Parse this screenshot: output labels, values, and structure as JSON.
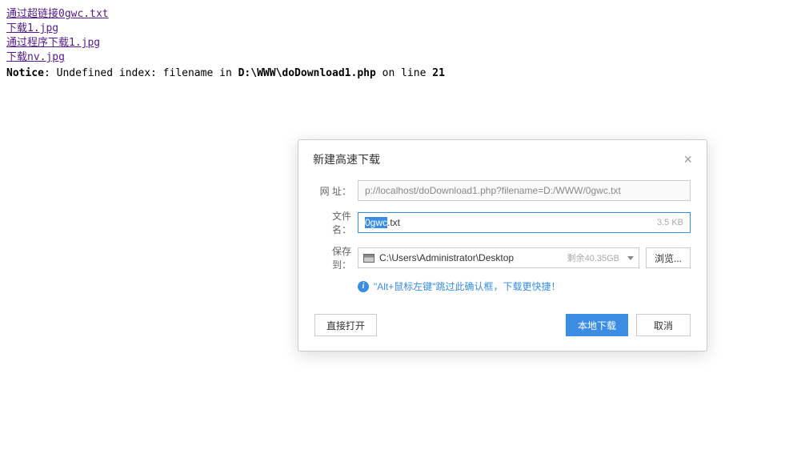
{
  "links": [
    "通过超链接0gwc.txt",
    "下载1.jpg",
    "通过程序下载1.jpg",
    "下载nv.jpg"
  ],
  "notice": {
    "prefix": "Notice",
    "message": ": Undefined index: filename in ",
    "path": "D:\\WWW\\doDownload1.php",
    "tail": " on line ",
    "line": "21"
  },
  "dialog": {
    "title": "新建高速下载",
    "url_label": "网 址：",
    "url_value": "p://localhost/doDownload1.php?filename=D:/WWW/0gwc.txt",
    "filename_label": "文件名：",
    "filename_sel": "0gwc",
    "filename_rest": ".txt",
    "file_size": "3.5 KB",
    "saveto_label": "保存到：",
    "saveto_path": "C:\\Users\\Administrator\\Desktop",
    "space_left": "剩余40.35GB",
    "browse": "浏览...",
    "hint": "\"Alt+鼠标左键\"跳过此确认框，下载更快捷！",
    "open_direct": "直接打开",
    "download_local": "本地下载",
    "cancel": "取消"
  }
}
